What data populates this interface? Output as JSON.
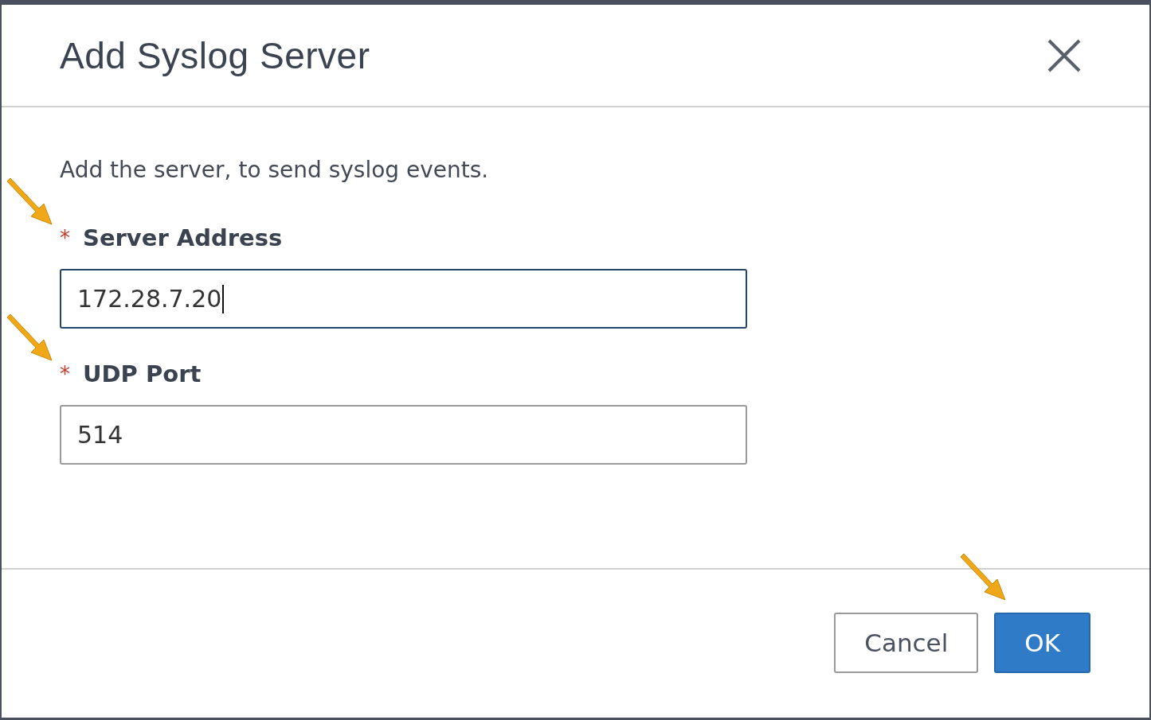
{
  "dialog": {
    "title": "Add Syslog Server",
    "description": "Add the server, to send syslog events.",
    "fields": [
      {
        "label": "Server Address",
        "required_mark": "*",
        "value": "172.28.7.20",
        "focused": true,
        "annotated": true
      },
      {
        "label": "UDP Port",
        "required_mark": "*",
        "value": "514",
        "focused": false,
        "annotated": true
      }
    ],
    "buttons": [
      {
        "label": "Cancel",
        "kind": "secondary",
        "annotated": false
      },
      {
        "label": "OK",
        "kind": "primary",
        "annotated": true
      }
    ]
  }
}
